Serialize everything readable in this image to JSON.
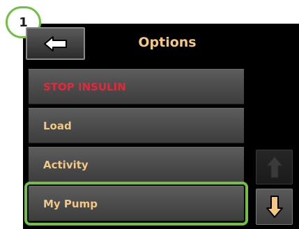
{
  "step_badge": {
    "number": "1"
  },
  "header": {
    "title": "Options",
    "back_icon": "arrow-left-icon"
  },
  "menu": {
    "items": [
      {
        "label": "STOP INSULIN",
        "color": "#e8263a"
      },
      {
        "label": "Load",
        "color": "#f2c884"
      },
      {
        "label": "Activity",
        "color": "#f2c884"
      },
      {
        "label": "My Pump",
        "color": "#f2c884",
        "highlighted": true
      }
    ]
  },
  "scroll": {
    "up_icon": "arrow-up-icon",
    "up_enabled": false,
    "down_icon": "arrow-down-icon",
    "down_enabled": true
  },
  "colors": {
    "accent_text": "#f2c884",
    "alert_text": "#e8263a",
    "highlight": "#72bf44",
    "background": "#000000"
  }
}
